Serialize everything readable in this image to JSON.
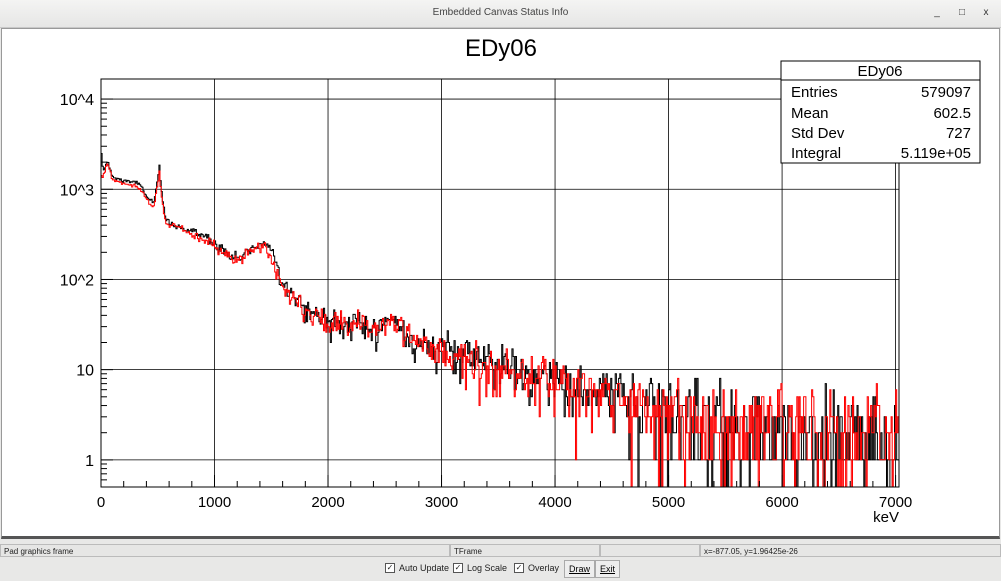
{
  "window": {
    "title": "Embedded Canvas Status Info",
    "controls": [
      "_",
      "□",
      "x"
    ]
  },
  "status_bar": [
    "Pad graphics frame",
    "TFrame",
    "",
    "x=-877.05, y=1.96425e-26"
  ],
  "controls": {
    "auto_update": {
      "label": "Auto Update",
      "checked": true
    },
    "log_scale": {
      "label": "Log Scale",
      "checked": true
    },
    "overlay": {
      "label": "Overlay",
      "checked": true
    },
    "draw_label": "Draw",
    "exit_label": "Exit"
  },
  "stats": {
    "title": "EDy06",
    "rows": [
      {
        "label": "Entries",
        "value": "579097"
      },
      {
        "label": "Mean",
        "value": "602.5"
      },
      {
        "label": "Std Dev",
        "value": "727"
      },
      {
        "label": "Integral",
        "value": "5.119e+05"
      }
    ]
  },
  "chart_data": {
    "type": "line",
    "title": "EDy06",
    "xlabel": "keV",
    "ylabel": "",
    "xlim": [
      0,
      7030
    ],
    "ylim": [
      0.5,
      16700
    ],
    "yscale": "log",
    "grid": true,
    "bin_width_keV": 10,
    "x_ticks": [
      0,
      1000,
      2000,
      3000,
      4000,
      5000,
      6000,
      7000
    ],
    "x_tick_labels": [
      "0",
      "1000",
      "2000",
      "3000",
      "4000",
      "5000",
      "6000",
      "7000"
    ],
    "y_ticks": [
      10000,
      1000,
      100,
      10,
      1
    ],
    "y_tick_labels": [
      "10^4",
      "10^3",
      "10^2",
      "10",
      "1"
    ],
    "series": [
      {
        "name": "black",
        "color": "#000000",
        "points": [
          [
            0,
            3000
          ],
          [
            20,
            1500
          ],
          [
            60,
            2100
          ],
          [
            100,
            1350
          ],
          [
            200,
            1250
          ],
          [
            300,
            1200
          ],
          [
            350,
            1100
          ],
          [
            420,
            780
          ],
          [
            470,
            720
          ],
          [
            500,
            1300
          ],
          [
            515,
            1750
          ],
          [
            540,
            800
          ],
          [
            570,
            450
          ],
          [
            650,
            400
          ],
          [
            750,
            360
          ],
          [
            850,
            320
          ],
          [
            950,
            290
          ],
          [
            1050,
            230
          ],
          [
            1150,
            180
          ],
          [
            1220,
            170
          ],
          [
            1300,
            210
          ],
          [
            1400,
            250
          ],
          [
            1480,
            240
          ],
          [
            1530,
            190
          ],
          [
            1580,
            110
          ],
          [
            1650,
            75
          ],
          [
            1750,
            55
          ],
          [
            1850,
            45
          ],
          [
            2000,
            35
          ],
          [
            2200,
            32
          ],
          [
            2400,
            30
          ],
          [
            2600,
            35
          ],
          [
            2700,
            28
          ],
          [
            2800,
            20
          ],
          [
            3000,
            16
          ],
          [
            3300,
            13
          ],
          [
            3600,
            10
          ],
          [
            4000,
            7
          ],
          [
            4500,
            5
          ],
          [
            5000,
            3.5
          ],
          [
            5500,
            2.8
          ],
          [
            6000,
            2.3
          ],
          [
            6500,
            2
          ],
          [
            7030,
            1.8
          ]
        ]
      },
      {
        "name": "red",
        "color": "#ff0000",
        "points": [
          [
            0,
            1500
          ],
          [
            20,
            1400
          ],
          [
            60,
            2000
          ],
          [
            100,
            1250
          ],
          [
            200,
            1150
          ],
          [
            300,
            1100
          ],
          [
            350,
            1000
          ],
          [
            420,
            700
          ],
          [
            470,
            660
          ],
          [
            500,
            1200
          ],
          [
            515,
            1600
          ],
          [
            540,
            700
          ],
          [
            570,
            420
          ],
          [
            650,
            380
          ],
          [
            750,
            340
          ],
          [
            850,
            300
          ],
          [
            950,
            270
          ],
          [
            1050,
            210
          ],
          [
            1150,
            165
          ],
          [
            1220,
            160
          ],
          [
            1300,
            200
          ],
          [
            1400,
            240
          ],
          [
            1460,
            230
          ],
          [
            1510,
            170
          ],
          [
            1560,
            100
          ],
          [
            1650,
            70
          ],
          [
            1750,
            50
          ],
          [
            1850,
            42
          ],
          [
            2000,
            33
          ],
          [
            2200,
            30
          ],
          [
            2400,
            28
          ],
          [
            2600,
            33
          ],
          [
            2700,
            27
          ],
          [
            2800,
            19
          ],
          [
            3000,
            15
          ],
          [
            3300,
            12
          ],
          [
            3600,
            10
          ],
          [
            4000,
            7
          ],
          [
            4500,
            5
          ],
          [
            5000,
            3.6
          ],
          [
            5500,
            2.9
          ],
          [
            6000,
            2.4
          ],
          [
            6500,
            2.1
          ],
          [
            7030,
            1.9
          ]
        ]
      }
    ]
  }
}
